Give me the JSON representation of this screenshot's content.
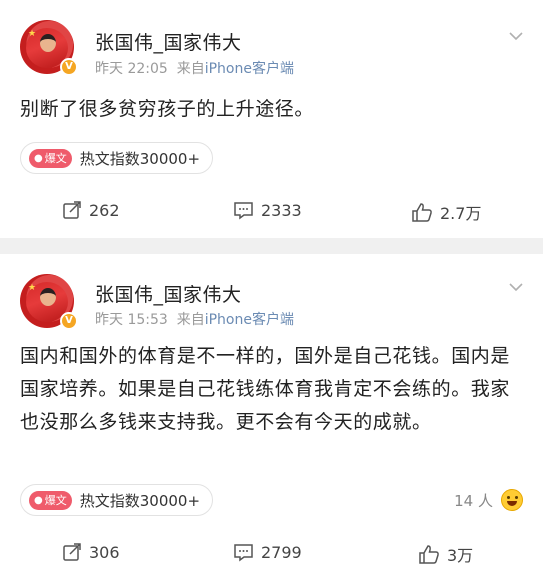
{
  "posts": [
    {
      "username": "张国伟_国家伟大",
      "time": "昨天 22:05",
      "source_prefix": "来自",
      "source": "iPhone客户端",
      "content": "别断了很多贫穷孩子的上升途径。",
      "hot_tag": "爆文",
      "hot_text": "热文指数30000+",
      "reposts": "262",
      "comments": "2333",
      "likes": "2.7万"
    },
    {
      "username": "张国伟_国家伟大",
      "time": "昨天 15:53",
      "source_prefix": "来自",
      "source": "iPhone客户端",
      "content": "国内和国外的体育是不一样的，国外是自己花钱。国内是国家培养。如果是自己花钱练体育我肯定不会练的。我家也没那么多钱来支持我。更不会有今天的成就。",
      "hot_tag": "爆文",
      "hot_text": "热文指数30000+",
      "likers": "14 人",
      "reposts": "306",
      "comments": "2799",
      "likes": "3万"
    }
  ],
  "icons": {
    "avatar_badge": "V",
    "menu": "chevron-down-icon",
    "repost": "repost-icon",
    "comment": "comment-icon",
    "like": "thumbs-up-icon"
  },
  "colors": {
    "hot_tag": "#ef5b6b",
    "verified_badge": "#f5a623",
    "source_link": "#6b8bb3"
  }
}
